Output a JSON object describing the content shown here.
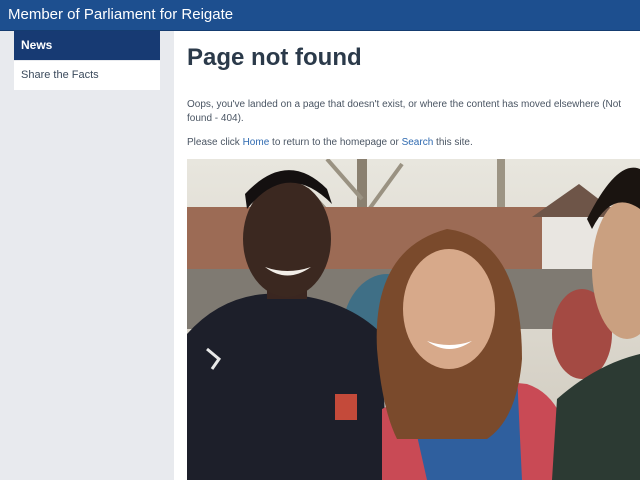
{
  "header": {
    "site_title": "Member of Parliament for Reigate"
  },
  "sidebar": {
    "items": [
      {
        "label": "News",
        "active": true
      },
      {
        "label": "Share the Facts",
        "active": false
      }
    ]
  },
  "main": {
    "title": "Page not found",
    "message": "Oops, you've landed on a page that doesn't exist, or where the content has moved elsewhere (Not found - 404).",
    "help_prefix": "Please click ",
    "home_link": "Home",
    "help_middle": " to return to the homepage or ",
    "search_link": "Search",
    "help_suffix": " this site."
  },
  "colors": {
    "header_bg": "#1d4f8f",
    "nav_active_bg": "#173a73",
    "link": "#2f6ab0",
    "sidebar_bg": "#e8eaee"
  }
}
